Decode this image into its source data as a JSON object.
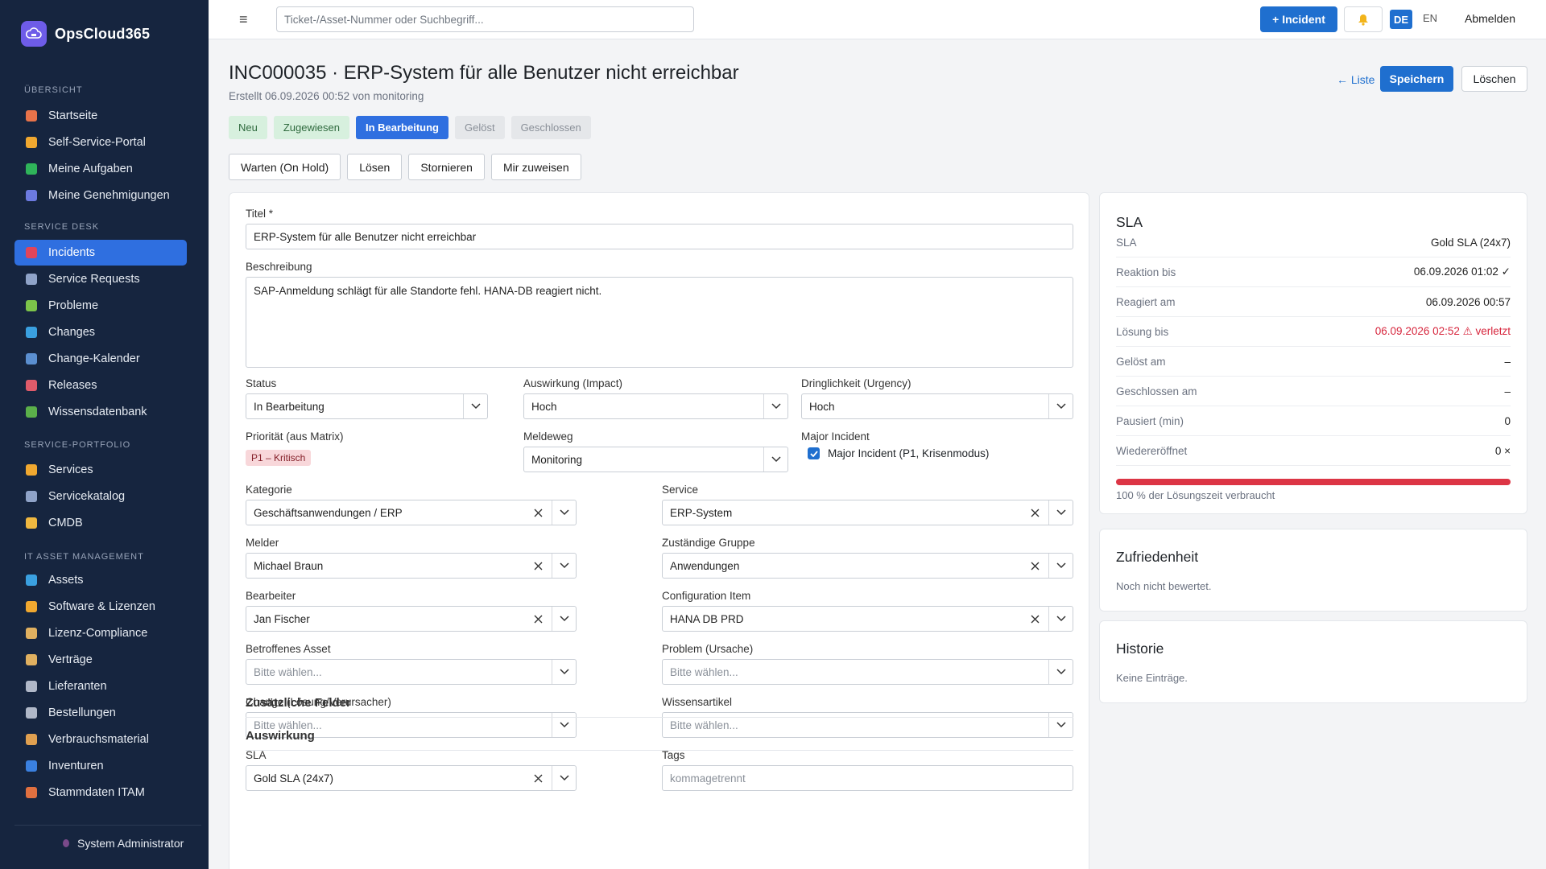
{
  "app": {
    "name": "OpsCloud365"
  },
  "sidebar": {
    "sections": [
      {
        "label": "ÜBERSICHT"
      },
      {
        "label": "SERVICE DESK"
      },
      {
        "label": "SERVICE-PORTFOLIO"
      },
      {
        "label": "IT ASSET MANAGEMENT"
      }
    ],
    "items": [
      {
        "label": "Startseite",
        "icon": "home-icon",
        "color": "#e8734a"
      },
      {
        "label": "Self-Service-Portal",
        "icon": "person-icon",
        "color": "#f0a830"
      },
      {
        "label": "Meine Aufgaben",
        "icon": "check-square-icon",
        "color": "#2fb45a"
      },
      {
        "label": "Meine Genehmigungen",
        "icon": "checkmark-icon",
        "color": "#6c7ae0"
      },
      {
        "label": "Incidents",
        "icon": "siren-icon",
        "color": "#e0455a"
      },
      {
        "label": "Service Requests",
        "icon": "envelope-icon",
        "color": "#8fa3c8"
      },
      {
        "label": "Probleme",
        "icon": "puzzle-icon",
        "color": "#7cc44a"
      },
      {
        "label": "Changes",
        "icon": "refresh-icon",
        "color": "#3aa0e0"
      },
      {
        "label": "Change-Kalender",
        "icon": "calendar-icon",
        "color": "#5b8fd0"
      },
      {
        "label": "Releases",
        "icon": "rocket-icon",
        "color": "#e05b6a"
      },
      {
        "label": "Wissensdatenbank",
        "icon": "books-icon",
        "color": "#5bb04a"
      },
      {
        "label": "Services",
        "icon": "bell-icon",
        "color": "#f0a830"
      },
      {
        "label": "Servicekatalog",
        "icon": "catalog-icon",
        "color": "#8fa3c8"
      },
      {
        "label": "CMDB",
        "icon": "folder-icon",
        "color": "#f0b840"
      },
      {
        "label": "Assets",
        "icon": "monitor-icon",
        "color": "#3aa0e0"
      },
      {
        "label": "Software & Lizenzen",
        "icon": "disc-icon",
        "color": "#f0a830"
      },
      {
        "label": "Lizenz-Compliance",
        "icon": "scale-icon",
        "color": "#e0b060"
      },
      {
        "label": "Verträge",
        "icon": "document-icon",
        "color": "#e0b060"
      },
      {
        "label": "Lieferanten",
        "icon": "building-icon",
        "color": "#b0b8c8"
      },
      {
        "label": "Bestellungen",
        "icon": "clipboard-icon",
        "color": "#b0b8c8"
      },
      {
        "label": "Verbrauchsmaterial",
        "icon": "box-icon",
        "color": "#e0a050"
      },
      {
        "label": "Inventuren",
        "icon": "magnifier-icon",
        "color": "#3a80e0"
      },
      {
        "label": "Stammdaten ITAM",
        "icon": "bricks-icon",
        "color": "#e07040"
      }
    ],
    "user": "System Administrator"
  },
  "topbar": {
    "search_placeholder": "Ticket-/Asset-Nummer oder Suchbegriff...",
    "new_incident": "+ Incident",
    "lang_de": "DE",
    "lang_en": "EN",
    "logout": "Abmelden"
  },
  "page": {
    "title": "INC000035 · ERP-System für alle Benutzer nicht erreichbar",
    "subtitle": "Erstellt 06.09.2026 00:52 von monitoring",
    "list_link": "← Liste",
    "save": "Speichern",
    "delete": "Löschen",
    "steps": [
      "Neu",
      "Zugewiesen",
      "In Bearbeitung",
      "Gelöst",
      "Geschlossen"
    ],
    "current_step": 2,
    "actions": [
      "Warten (On Hold)",
      "Lösen",
      "Stornieren",
      "Mir zuweisen"
    ]
  },
  "form": {
    "title_label": "Titel *",
    "title_value": "ERP-System für alle Benutzer nicht erreichbar",
    "desc_label": "Beschreibung",
    "desc_value": "SAP-Anmeldung schlägt für alle Standorte fehl. HANA-DB reagiert nicht.",
    "status_label": "Status",
    "status_value": "In Bearbeitung",
    "impact_label": "Auswirkung (Impact)",
    "impact_value": "Hoch",
    "urgency_label": "Dringlichkeit (Urgency)",
    "urgency_value": "Hoch",
    "priority_label": "Priorität (aus Matrix)",
    "priority_value": "P1 – Kritisch",
    "channel_label": "Meldeweg",
    "channel_value": "Monitoring",
    "major_label": "Major Incident",
    "major_check": "Major Incident (P1, Krisenmodus)",
    "major_checked": true,
    "category_label": "Kategorie",
    "category_value": "Geschäftsanwendungen / ERP",
    "service_label": "Service",
    "service_value": "ERP-System",
    "reporter_label": "Melder",
    "reporter_value": "Michael Braun",
    "group_label": "Zuständige Gruppe",
    "group_value": "Anwendungen",
    "assignee_label": "Bearbeiter",
    "assignee_value": "Jan Fischer",
    "ci_label": "Configuration Item",
    "ci_value": "HANA DB PRD",
    "asset_label": "Betroffenes Asset",
    "problem_label": "Problem (Ursache)",
    "change_label": "Change (Lösung/Verursacher)",
    "kb_label": "Wissensartikel",
    "choose_placeholder": "Bitte wählen...",
    "sla_label": "SLA",
    "sla_value": "Gold SLA (24x7)",
    "tags_label": "Tags",
    "tags_placeholder": "kommagetrennt",
    "extra_header": "Zusätzliche Felder",
    "impact_header": "Auswirkung"
  },
  "sla_panel": {
    "title": "SLA",
    "rows": [
      {
        "key": "SLA",
        "value": "Gold SLA (24x7)"
      },
      {
        "key": "Reaktion bis",
        "value": "06.09.2026 01:02 ✓"
      },
      {
        "key": "Reagiert am",
        "value": "06.09.2026 00:57"
      },
      {
        "key": "Lösung bis",
        "value": "06.09.2026 02:52 ⚠ verletzt"
      },
      {
        "key": "Gelöst am",
        "value": "–"
      },
      {
        "key": "Geschlossen am",
        "value": "–"
      },
      {
        "key": "Pausiert (min)",
        "value": "0"
      },
      {
        "key": "Wiedereröffnet",
        "value": "0 ×"
      }
    ],
    "progress": 1.0,
    "progress_label": "100 % der Lösungszeit verbraucht",
    "bar_color": "#dc3545"
  },
  "satisfaction": {
    "title": "Zufriedenheit",
    "text": "Noch nicht bewertet."
  },
  "history": {
    "title": "Historie",
    "text": "Keine Einträge."
  }
}
